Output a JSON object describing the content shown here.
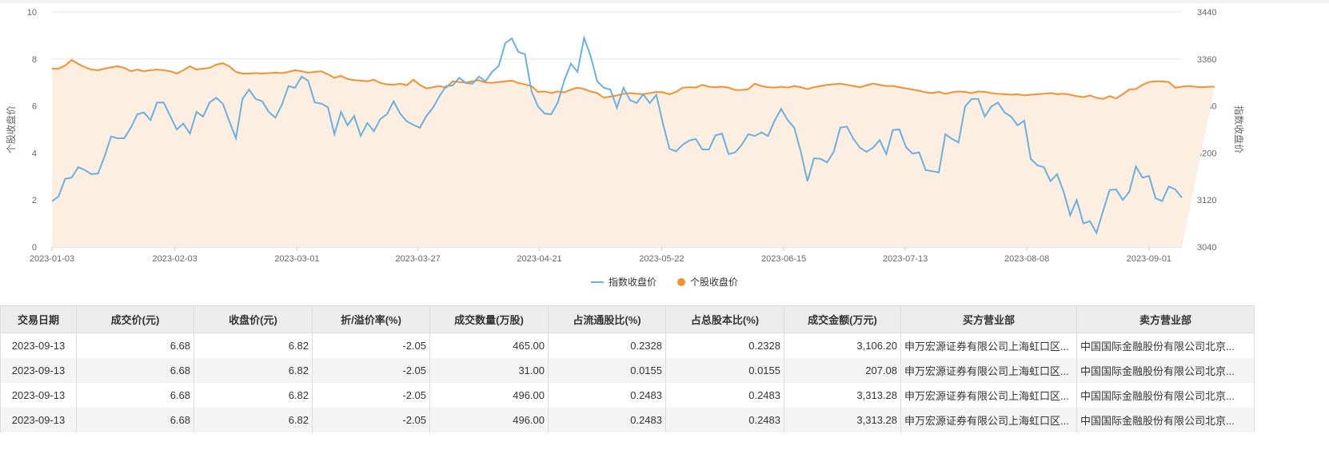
{
  "chart_data": {
    "type": "line",
    "left_axis": {
      "label": "个股收盘价",
      "ylim": [
        0,
        10
      ],
      "ticks": [
        "0",
        "2",
        "4",
        "6",
        "8",
        "10"
      ]
    },
    "right_axis": {
      "label": "指数收盘价",
      "ylim": [
        3040,
        3440
      ],
      "ticks": [
        "3040",
        "3120",
        "3200",
        "3280",
        "3360",
        "3440"
      ]
    },
    "x_ticks": [
      {
        "index": 0,
        "label": "2023-01-03"
      },
      {
        "index": 18.7,
        "label": "2023-02-03"
      },
      {
        "index": 37.3,
        "label": "2023-03-01"
      },
      {
        "index": 55.7,
        "label": "2023-03-27"
      },
      {
        "index": 74.2,
        "label": "2023-04-21"
      },
      {
        "index": 92.8,
        "label": "2023-05-22"
      },
      {
        "index": 111.4,
        "label": "2023-06-15"
      },
      {
        "index": 129.9,
        "label": "2023-07-13"
      },
      {
        "index": 148.4,
        "label": "2023-08-08"
      },
      {
        "index": 167,
        "label": "2023-09-01"
      }
    ],
    "grid": true,
    "legend_position": "bottom-center",
    "series": [
      {
        "name": "指数收盘价",
        "axis": "right",
        "color": "#6ab0e0",
        "values": [
          3118,
          3126,
          3156,
          3158,
          3176,
          3171,
          3164,
          3165,
          3194,
          3228,
          3225,
          3225,
          3243,
          3266,
          3269,
          3256,
          3286,
          3286,
          3263,
          3240,
          3250,
          3233,
          3270,
          3262,
          3286,
          3294,
          3284,
          3254,
          3225,
          3292,
          3308,
          3292,
          3288,
          3270,
          3260,
          3282,
          3314,
          3311,
          3330,
          3323,
          3286,
          3284,
          3278,
          3232,
          3270,
          3247,
          3263,
          3229,
          3251,
          3237,
          3258,
          3266,
          3288,
          3267,
          3254,
          3248,
          3243,
          3263,
          3277,
          3297,
          3314,
          3315,
          3328,
          3319,
          3318,
          3330,
          3322,
          3338,
          3348,
          3387,
          3395,
          3372,
          3368,
          3305,
          3279,
          3267,
          3266,
          3286,
          3324,
          3352,
          3338,
          3396,
          3365,
          3322,
          3311,
          3308,
          3277,
          3311,
          3290,
          3285,
          3300,
          3285,
          3299,
          3250,
          3207,
          3203,
          3214,
          3221,
          3224,
          3206,
          3206,
          3230,
          3233,
          3198,
          3201,
          3214,
          3232,
          3229,
          3235,
          3229,
          3255,
          3275,
          3256,
          3243,
          3202,
          3152,
          3191,
          3190,
          3184,
          3202,
          3243,
          3245,
          3224,
          3209,
          3202,
          3209,
          3222,
          3198,
          3239,
          3240,
          3210,
          3199,
          3201,
          3171,
          3169,
          3167,
          3232,
          3224,
          3218,
          3279,
          3292,
          3292,
          3262,
          3279,
          3286,
          3269,
          3262,
          3247,
          3255,
          3190,
          3179,
          3176,
          3152,
          3164,
          3134,
          3094,
          3120,
          3080,
          3084,
          3064,
          3101,
          3137,
          3138,
          3120,
          3134,
          3177,
          3158,
          3161,
          3123,
          3118,
          3143,
          3138,
          3124
        ]
      },
      {
        "name": "个股收盘价",
        "axis": "left",
        "color": "#f5902e",
        "fill": "#fdeee2",
        "values": [
          7.59,
          7.59,
          7.72,
          7.96,
          7.79,
          7.65,
          7.55,
          7.52,
          7.59,
          7.65,
          7.69,
          7.62,
          7.48,
          7.55,
          7.48,
          7.52,
          7.55,
          7.52,
          7.48,
          7.38,
          7.52,
          7.69,
          7.55,
          7.59,
          7.62,
          7.76,
          7.82,
          7.69,
          7.45,
          7.38,
          7.38,
          7.4,
          7.38,
          7.4,
          7.42,
          7.4,
          7.45,
          7.52,
          7.48,
          7.42,
          7.45,
          7.48,
          7.35,
          7.2,
          7.28,
          7.15,
          7.1,
          7.08,
          7.05,
          7.12,
          6.98,
          6.92,
          6.9,
          6.95,
          6.88,
          7.12,
          6.9,
          6.75,
          6.8,
          6.85,
          6.78,
          7.05,
          7.02,
          7.0,
          7.05,
          7.1,
          7.0,
          6.98,
          7.02,
          7.05,
          7.08,
          6.98,
          6.92,
          6.85,
          6.6,
          6.62,
          6.55,
          6.62,
          6.58,
          6.7,
          6.78,
          6.72,
          6.62,
          6.55,
          6.35,
          6.4,
          6.45,
          6.52,
          6.55,
          6.52,
          6.5,
          6.55,
          6.6,
          6.58,
          6.5,
          6.6,
          6.78,
          6.8,
          6.78,
          6.9,
          6.82,
          6.8,
          6.82,
          6.78,
          6.68,
          6.68,
          6.72,
          6.95,
          6.85,
          6.8,
          6.78,
          6.82,
          6.78,
          6.85,
          6.8,
          6.72,
          6.8,
          6.85,
          6.9,
          6.92,
          6.95,
          6.9,
          6.85,
          6.8,
          6.88,
          6.95,
          6.9,
          6.85,
          6.85,
          6.8,
          6.75,
          6.7,
          6.65,
          6.58,
          6.55,
          6.6,
          6.52,
          6.58,
          6.62,
          6.6,
          6.55,
          6.62,
          6.6,
          6.55,
          6.52,
          6.5,
          6.48,
          6.5,
          6.45,
          6.48,
          6.5,
          6.52,
          6.55,
          6.5,
          6.52,
          6.48,
          6.42,
          6.38,
          6.45,
          6.35,
          6.3,
          6.42,
          6.32,
          6.5,
          6.7,
          6.72,
          6.9,
          7.02,
          7.05,
          7.05,
          7.02,
          6.78,
          6.82,
          6.85,
          6.82,
          6.8,
          6.82,
          6.82
        ]
      }
    ]
  },
  "table": {
    "headers": [
      "交易日期",
      "成交价(元)",
      "收盘价(元)",
      "折/溢价率(%)",
      "成交数量(万股)",
      "占流通股比(%)",
      "占总股本比(%)",
      "成交金额(万元)",
      "买方营业部",
      "卖方营业部"
    ],
    "rows": [
      [
        "2023-09-13",
        "6.68",
        "6.82",
        "-2.05",
        "465.00",
        "0.2328",
        "0.2328",
        "3,106.20",
        "申万宏源证券有限公司上海虹口区...",
        "中国国际金融股份有限公司北京..."
      ],
      [
        "2023-09-13",
        "6.68",
        "6.82",
        "-2.05",
        "31.00",
        "0.0155",
        "0.0155",
        "207.08",
        "申万宏源证券有限公司上海虹口区...",
        "中国国际金融股份有限公司北京..."
      ],
      [
        "2023-09-13",
        "6.68",
        "6.82",
        "-2.05",
        "496.00",
        "0.2483",
        "0.2483",
        "3,313.28",
        "申万宏源证券有限公司上海虹口区...",
        "中国国际金融股份有限公司北京..."
      ],
      [
        "2023-09-13",
        "6.68",
        "6.82",
        "-2.05",
        "496.00",
        "0.2483",
        "0.2483",
        "3,313.28",
        "申万宏源证券有限公司上海虹口区...",
        "中国国际金融股份有限公司北京..."
      ]
    ]
  }
}
